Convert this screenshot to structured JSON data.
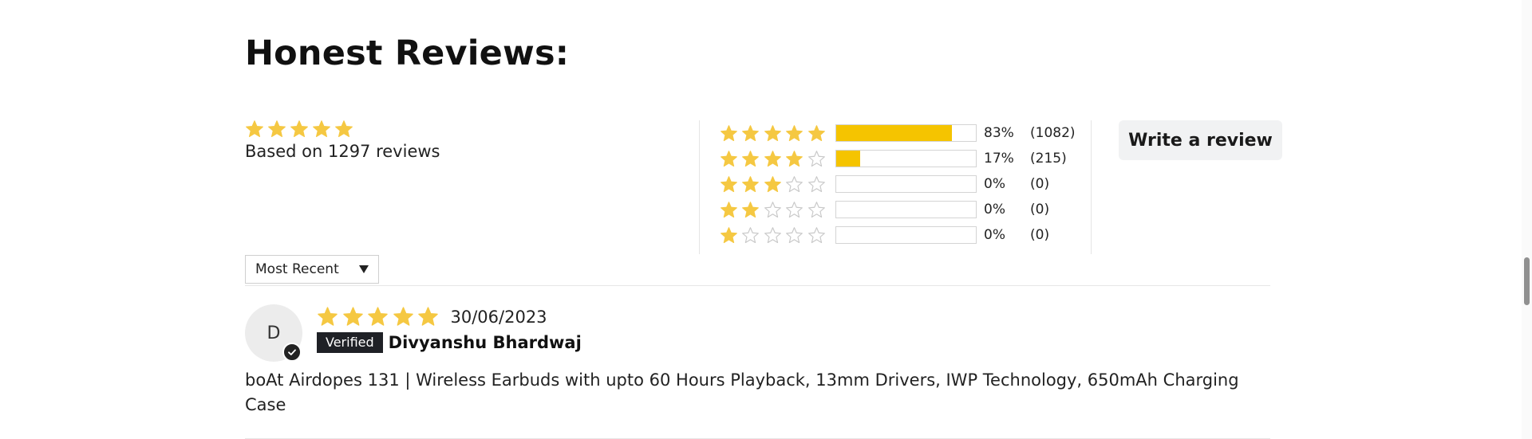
{
  "section": {
    "title": "Honest Reviews:"
  },
  "summary": {
    "stars_filled": 5,
    "based_on": "Based on 1297 reviews"
  },
  "histogram": [
    {
      "stars": 5,
      "percent": "83%",
      "count": "(1082)",
      "fill": 0.83
    },
    {
      "stars": 4,
      "percent": "17%",
      "count": "(215)",
      "fill": 0.17
    },
    {
      "stars": 3,
      "percent": "0%",
      "count": "(0)",
      "fill": 0
    },
    {
      "stars": 2,
      "percent": "0%",
      "count": "(0)",
      "fill": 0
    },
    {
      "stars": 1,
      "percent": "0%",
      "count": "(0)",
      "fill": 0
    }
  ],
  "actions": {
    "write_review": "Write a review"
  },
  "sort": {
    "selected": "Most Recent"
  },
  "reviews": [
    {
      "avatar_initial": "D",
      "stars": 5,
      "date": "30/06/2023",
      "verified_label": "Verified",
      "author": "Divyanshu Bhardwaj",
      "body": "boAt Airdopes 131 | Wireless Earbuds with upto 60 Hours Playback, 13mm Drivers, IWP Technology, 650mAh Charging Case"
    }
  ],
  "colors": {
    "star_filled": "#f5c842",
    "star_empty_stroke": "#c8c8c8",
    "bar_fill": "#f5c400",
    "button_bg": "#f1f2f3",
    "verified_bg": "#1f2126"
  },
  "icons": {
    "filled_star": "filled-star-icon",
    "empty_star": "empty-star-icon",
    "dropdown": "caret-down-icon",
    "verified": "check-badge-icon"
  }
}
